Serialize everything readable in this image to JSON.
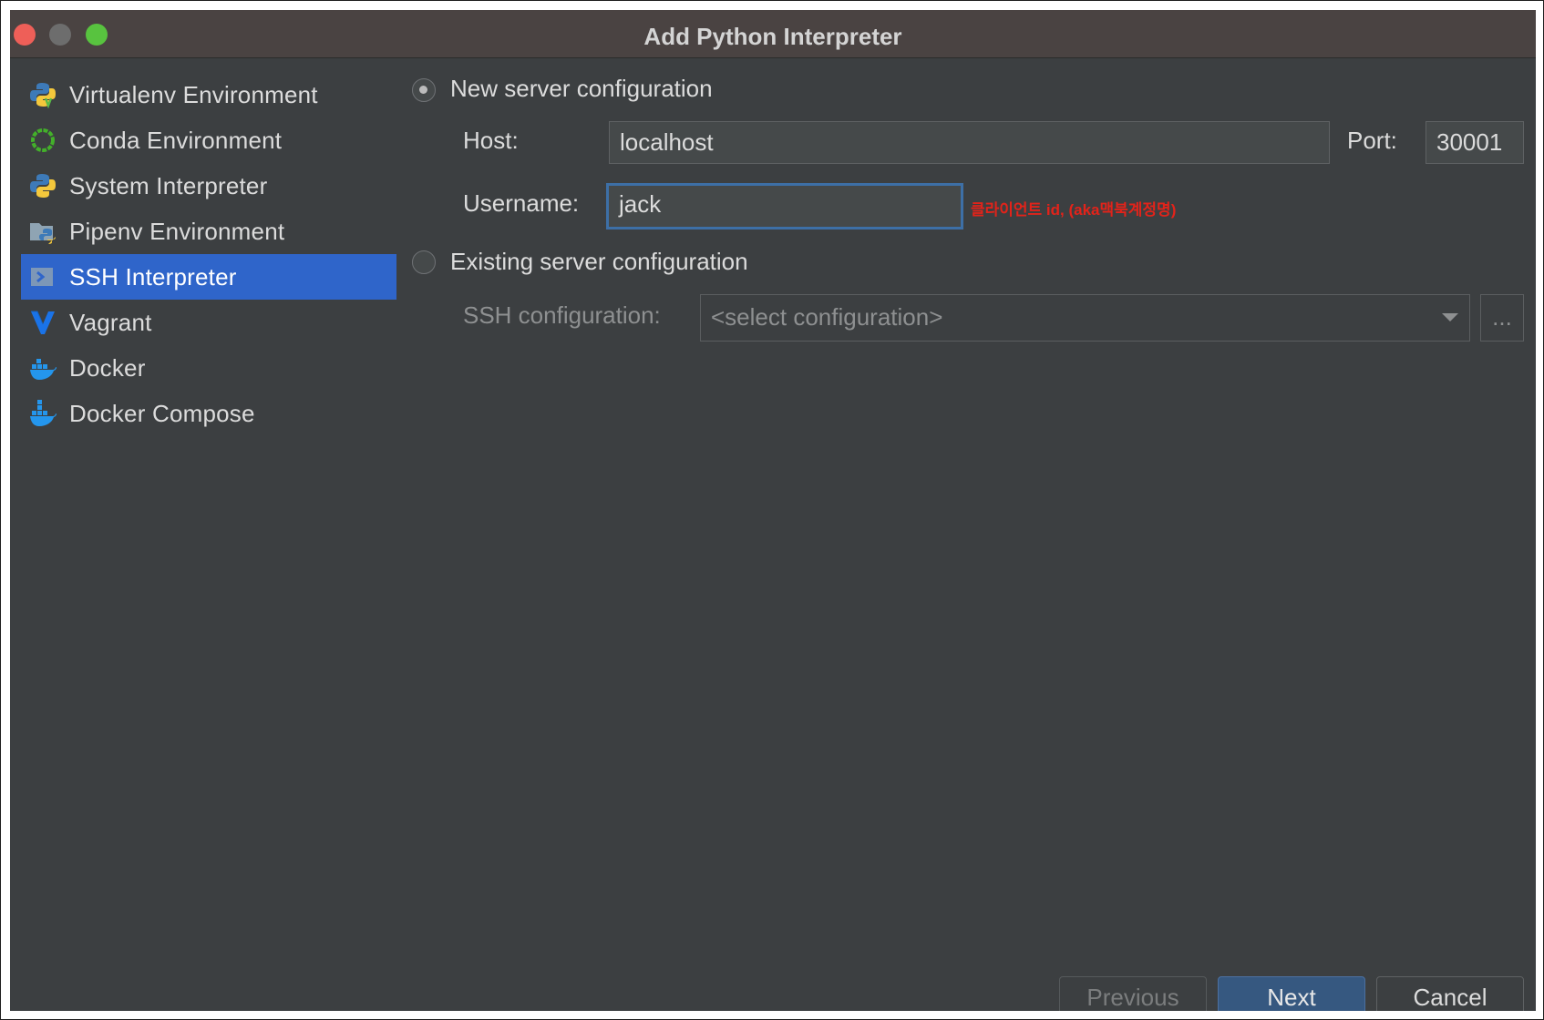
{
  "window": {
    "title": "Add Python Interpreter"
  },
  "sidebar": {
    "items": [
      {
        "label": "Virtualenv Environment",
        "icon": "python-virtualenv-icon"
      },
      {
        "label": "Conda Environment",
        "icon": "conda-icon"
      },
      {
        "label": "System Interpreter",
        "icon": "python-icon"
      },
      {
        "label": "Pipenv Environment",
        "icon": "pipenv-icon"
      },
      {
        "label": "SSH Interpreter",
        "icon": "ssh-icon",
        "selected": true
      },
      {
        "label": "Vagrant",
        "icon": "vagrant-icon"
      },
      {
        "label": "Docker",
        "icon": "docker-icon"
      },
      {
        "label": "Docker Compose",
        "icon": "docker-compose-icon"
      }
    ]
  },
  "form": {
    "new_server": {
      "label": "New server configuration",
      "selected": true
    },
    "host": {
      "label": "Host:",
      "value": "localhost"
    },
    "port": {
      "label": "Port:",
      "value": "30001"
    },
    "username": {
      "label": "Username:",
      "value": "jack"
    },
    "annotation": "클라이언트 id, (aka맥북계정명)",
    "existing_server": {
      "label": "Existing server configuration",
      "selected": false
    },
    "ssh_config": {
      "label": "SSH configuration:",
      "placeholder": "<select configuration>",
      "browse": "..."
    }
  },
  "buttons": {
    "previous": "Previous",
    "next": "Next",
    "cancel": "Cancel"
  },
  "colors": {
    "selection": "#2f65ca",
    "background": "#3c3f41",
    "annotation": "#e2231a",
    "focus": "#3d6fa6"
  }
}
